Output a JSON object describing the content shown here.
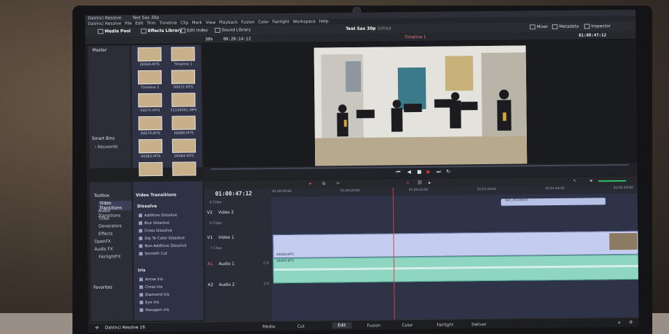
{
  "window": {
    "app_title": "DaVinci Resolve",
    "project_title": "Test Sax 30p",
    "menu": [
      "DaVinci Resolve",
      "File",
      "Edit",
      "Trim",
      "Timeline",
      "Clip",
      "Mark",
      "View",
      "Playback",
      "Fusion",
      "Color",
      "Fairlight",
      "Workspace",
      "Help"
    ]
  },
  "toolbar": {
    "media_pool": "Media Pool",
    "effects_library": "Effects Library",
    "edit_index": "Edit Index",
    "sound_library": "Sound Library",
    "project_name": "Test Sax 30p",
    "project_status": "Edited",
    "mixer": "Mixer",
    "metadata": "Metadata",
    "inspector": "Inspector",
    "timecode": "01:00:47:12"
  },
  "subbar": {
    "zoom": "38%",
    "source_tc": "00:20:14:12",
    "timeline_name": "Timeline 1"
  },
  "media_pool": {
    "bin_master": "Master",
    "smart_bins": "Smart Bins",
    "keywords": "Keywords",
    "clips": [
      "00069.MTS",
      "Timeline 1",
      "Timeline 2",
      "00072.MTS",
      "00075.MTS",
      "51530001.MP4",
      "00079.MTS",
      "00080.MTS",
      "00083.MTS",
      "00084.MTS",
      "",
      ""
    ]
  },
  "effects": {
    "toolbox": "Toolbox",
    "tree": [
      "Video Transitions",
      "Audio Transitions",
      "Titles",
      "Generators",
      "Effects",
      "OpenFX",
      "Audio FX",
      "FairlightFX"
    ],
    "favorites": "Favorites",
    "panel_title": "Video Transitions",
    "group_dissolve": "Dissolve",
    "dissolve_items": [
      "Additive Dissolve",
      "Blur Dissolve",
      "Cross Dissolve",
      "Dip To Color Dissolve",
      "Non-Additive Dissolve",
      "Smooth Cut"
    ],
    "group_iris": "Iris",
    "iris_items": [
      "Arrow Iris",
      "Cross Iris",
      "Diamond Iris",
      "Eye Iris",
      "Hexagon Iris"
    ]
  },
  "timeline": {
    "timecode": "01:00:47:12",
    "ruler": [
      "01:00:00:00",
      "01:00:26:00",
      "01:00:52:00",
      "01:01:18:00",
      "01:01:44:00",
      "01:02:10:00"
    ],
    "tracks": [
      {
        "id": "V2",
        "name": "Video 2",
        "clips": "0 Clips"
      },
      {
        "id": "V1",
        "name": "Video 1",
        "clips": "7 Clips"
      },
      {
        "id": "A1",
        "name": "Audio 1",
        "level": "2.0"
      },
      {
        "id": "A2",
        "name": "Audio 2",
        "level": "2.0"
      }
    ],
    "top_clips_label": "0 Clips",
    "v2_clip": "Sax_20190825",
    "v1_clip": "00069.MTS",
    "a1_clip": "00069.MTS"
  },
  "pages": [
    "Media",
    "Cut",
    "Edit",
    "Fusion",
    "Color",
    "Fairlight",
    "Deliver"
  ],
  "active_page": "Edit",
  "footer": {
    "brand": "DaVinci Resolve 16"
  }
}
